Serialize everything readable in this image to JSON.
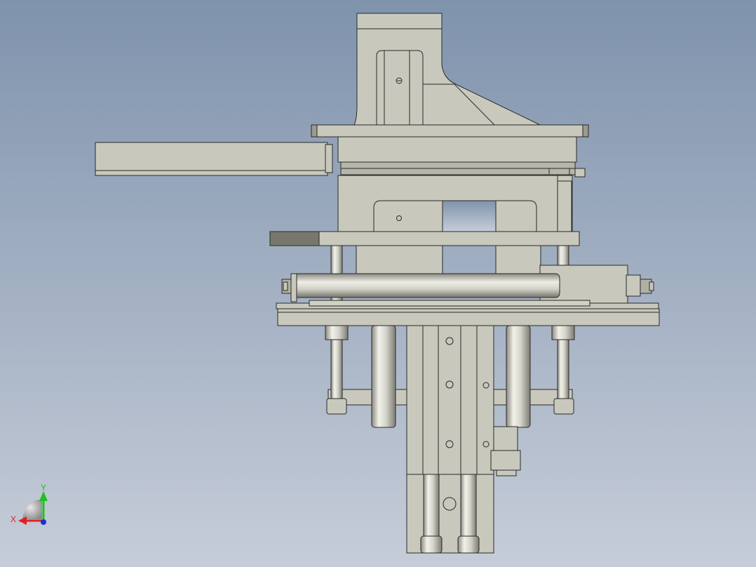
{
  "viewport": {
    "background_top": "#7f93ad",
    "background_bottom": "#c6cdd8"
  },
  "model": {
    "part_fill": "#c8c8bc",
    "part_dark": "#77776d",
    "edge": "#2a2a2a"
  },
  "triad": {
    "x_label": "X",
    "y_label": "Y",
    "x_color": "#e02020",
    "y_color": "#20c020",
    "z_color": "#2030d0"
  }
}
